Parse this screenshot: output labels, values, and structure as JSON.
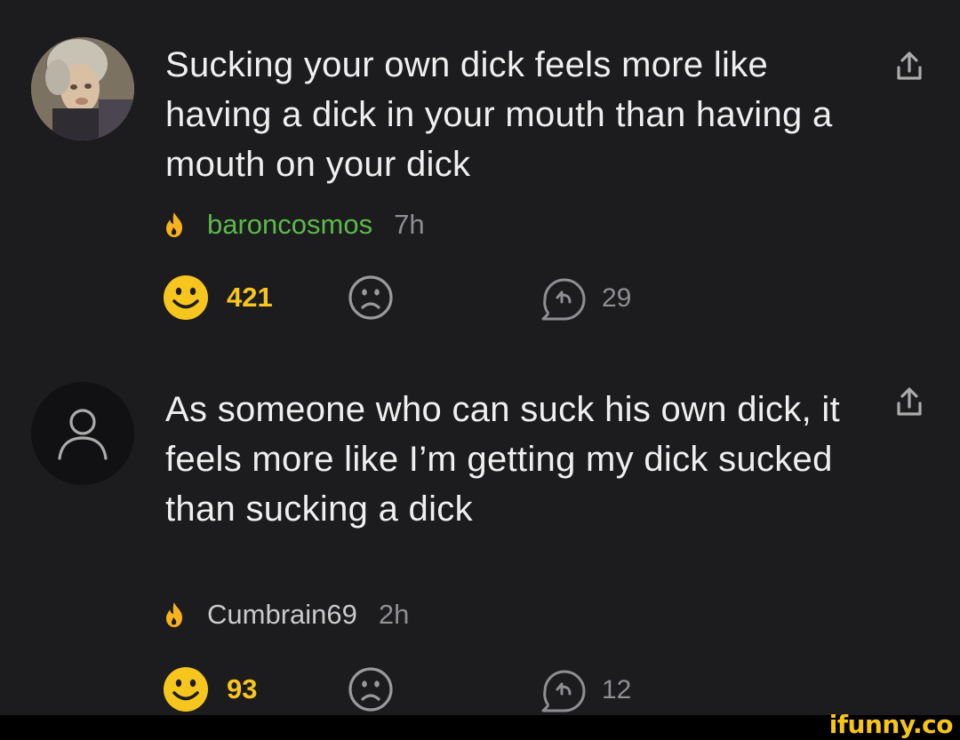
{
  "comments": [
    {
      "text": "Sucking your own dick feels more like having a dick in your mouth than having a mouth on your dick",
      "username": "baroncosmos",
      "time": "7h",
      "upvotes": "421",
      "replies": "29",
      "username_color": "#5cb84a"
    },
    {
      "text": "As someone who can suck his own dick, it feels more like I’m getting my dick sucked than sucking a dick",
      "username": "Cumbrain69",
      "time": "2h",
      "upvotes": "93",
      "replies": "12",
      "username_color": "#c9c9c9"
    }
  ],
  "watermark": "ifunny.co",
  "colors": {
    "background": "#1c1c1e",
    "smile": "#f7c61e",
    "flame": "#f7b21e"
  },
  "icons": [
    "avatar",
    "share-icon",
    "flame-icon",
    "smile-icon",
    "sad-icon",
    "reply-icon"
  ]
}
